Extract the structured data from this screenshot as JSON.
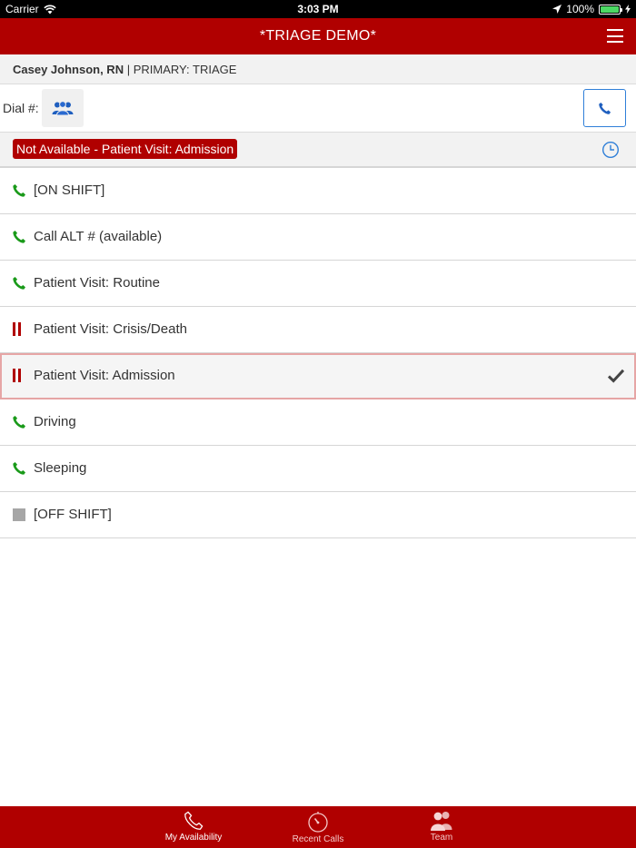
{
  "status_bar": {
    "carrier": "Carrier",
    "time": "3:03 PM",
    "battery": "100%",
    "battery_level": 1.0
  },
  "nav": {
    "title": "*TRIAGE DEMO*",
    "menu_icon": "hamburger-menu-icon"
  },
  "user": {
    "name": "Casey Johnson, RN",
    "separator": "|",
    "role": "PRIMARY: TRIAGE"
  },
  "dial": {
    "label": "Dial #:",
    "team_icon": "team-icon",
    "call_icon": "phone-icon"
  },
  "current_status": {
    "label": "Not Available - Patient Visit: Admission",
    "history_icon": "clock-icon"
  },
  "availability_options": [
    {
      "label": "[ON SHIFT]",
      "icon": "phone-available-icon",
      "selected": false
    },
    {
      "label": "Call ALT # (available)",
      "icon": "phone-available-icon",
      "selected": false
    },
    {
      "label": "Patient Visit: Routine",
      "icon": "phone-available-icon",
      "selected": false
    },
    {
      "label": "Patient Visit: Crisis/Death",
      "icon": "pause-unavailable-icon",
      "selected": false
    },
    {
      "label": "Patient Visit: Admission",
      "icon": "pause-unavailable-icon",
      "selected": true
    },
    {
      "label": "Driving",
      "icon": "phone-available-icon",
      "selected": false
    },
    {
      "label": "Sleeping",
      "icon": "phone-available-icon",
      "selected": false
    },
    {
      "label": "[OFF SHIFT]",
      "icon": "off-shift-square-icon",
      "selected": false
    }
  ],
  "tabs": [
    {
      "label": "My Availability",
      "icon": "phone-icon",
      "active": true
    },
    {
      "label": "Recent Calls",
      "icon": "stopwatch-icon",
      "active": false
    },
    {
      "label": "Team",
      "icon": "team-icon",
      "active": false
    }
  ],
  "colors": {
    "brand_red": "#b00000",
    "available_green": "#1a9a1a",
    "accent_blue": "#2f7fd8",
    "off_gray": "#a6a6a6"
  }
}
